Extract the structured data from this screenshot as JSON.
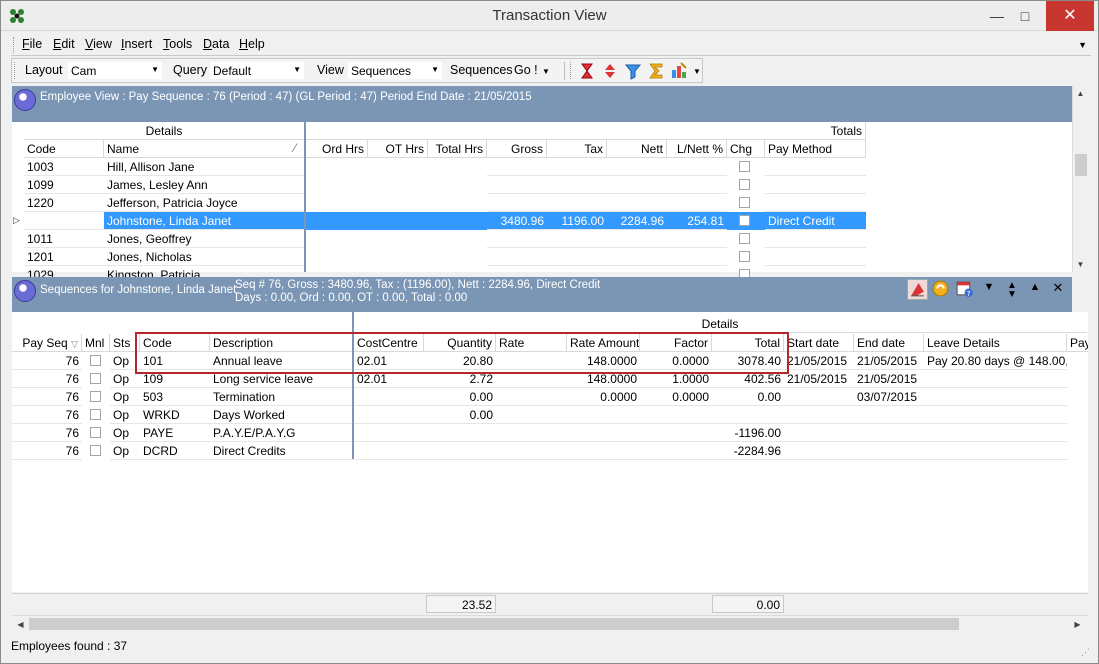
{
  "window": {
    "title": "Transaction View"
  },
  "menu": [
    {
      "label": "File",
      "u": "F",
      "rest": "ile"
    },
    {
      "label": "Edit",
      "u": "E",
      "rest": "dit"
    },
    {
      "label": "View",
      "u": "V",
      "rest": "iew"
    },
    {
      "label": "Insert",
      "u": "I",
      "rest": "nsert"
    },
    {
      "label": "Tools",
      "u": "T",
      "rest": "ools"
    },
    {
      "label": "Data",
      "u": "D",
      "rest": "ata"
    },
    {
      "label": "Help",
      "u": "H",
      "rest": "elp"
    }
  ],
  "toolbar": {
    "layout_label": "Layout",
    "layout_value": "Cam",
    "query_label": "Query",
    "query_value": "Default",
    "view_label": "View",
    "view_value": "Sequences",
    "sequences_label": "Sequences",
    "go_label": "Go !"
  },
  "employee_view": {
    "header": "Employee View : Pay Sequence : 76 (Period : 47) (GL Period : 47) Period End Date : 21/05/2015",
    "group_details": "Details",
    "group_totals": "Totals",
    "columns": [
      "Code",
      "Name",
      "Ord Hrs",
      "OT Hrs",
      "Total Hrs",
      "Gross",
      "Tax",
      "Nett",
      "L/Nett %",
      "Chg",
      "Pay Method"
    ],
    "rows": [
      {
        "code": "1003",
        "name": "Hill, Allison Jane",
        "gross": "",
        "tax": "",
        "nett": "",
        "lnett": "",
        "method": ""
      },
      {
        "code": "1099",
        "name": "James, Lesley Ann",
        "gross": "",
        "tax": "",
        "nett": "",
        "lnett": "",
        "method": ""
      },
      {
        "code": "1220",
        "name": "Jefferson, Patricia Joyce",
        "gross": "",
        "tax": "",
        "nett": "",
        "lnett": "",
        "method": ""
      },
      {
        "code": "1008",
        "name": "Johnstone, Linda Janet",
        "gross": "3480.96",
        "tax": "1196.00",
        "nett": "2284.96",
        "lnett": "254.81",
        "method": "Direct Credit"
      },
      {
        "code": "1011",
        "name": "Jones, Geoffrey",
        "gross": "",
        "tax": "",
        "nett": "",
        "lnett": "",
        "method": ""
      },
      {
        "code": "1201",
        "name": "Jones, Nicholas",
        "gross": "",
        "tax": "",
        "nett": "",
        "lnett": "",
        "method": ""
      },
      {
        "code": "1029",
        "name": "Kingston, Patricia",
        "gross": "",
        "tax": "",
        "nett": "",
        "lnett": "",
        "method": ""
      }
    ]
  },
  "sequences": {
    "header_title": "Sequences  for Johnstone, Linda Janet",
    "header_line1": "Seq # 76, Gross : 3480.96, Tax : (1196.00), Nett : 2284.96, Direct Credit",
    "header_line2": "Days : 0.00, Ord : 0.00, OT : 0.00, Total : 0.00",
    "group_details": "Details",
    "columns": [
      "Pay Seq",
      "Mnl",
      "Sts",
      "Code",
      "Description",
      "CostCentre",
      "Quantity",
      "Rate",
      "Rate Amount",
      "Factor",
      "Total",
      "Start date",
      "End date",
      "Leave Details",
      "Pay"
    ],
    "rows": [
      {
        "seq": "76",
        "sts": "Op",
        "code": "101",
        "desc": "Annual leave",
        "cc": "02.01",
        "qty": "20.80",
        "rate_amt": "148.0000",
        "factor": "0.0000",
        "total": "3078.40",
        "start": "21/05/2015",
        "end": "21/05/2015",
        "leave": "Pay 20.80 days @ 148.00, re"
      },
      {
        "seq": "76",
        "sts": "Op",
        "code": "109",
        "desc": "Long service leave",
        "cc": "02.01",
        "qty": "2.72",
        "rate_amt": "148.0000",
        "factor": "1.0000",
        "total": "402.56",
        "start": "21/05/2015",
        "end": "21/05/2015",
        "leave": ""
      },
      {
        "seq": "76",
        "sts": "Op",
        "code": "503",
        "desc": "Termination",
        "cc": "",
        "qty": "0.00",
        "rate_amt": "0.0000",
        "factor": "0.0000",
        "total": "0.00",
        "start": "",
        "end": "03/07/2015",
        "leave": ""
      },
      {
        "seq": "76",
        "sts": "Op",
        "code": "WRKD",
        "desc": "Days Worked",
        "cc": "",
        "qty": "0.00",
        "rate_amt": "",
        "factor": "",
        "total": "",
        "start": "",
        "end": "",
        "leave": ""
      },
      {
        "seq": "76",
        "sts": "Op",
        "code": "PAYE",
        "desc": "P.A.Y.E/P.A.Y.G",
        "cc": "",
        "qty": "",
        "rate_amt": "",
        "factor": "",
        "total": "-1196.00",
        "start": "",
        "end": "",
        "leave": ""
      },
      {
        "seq": "76",
        "sts": "Op",
        "code": "DCRD",
        "desc": "Direct Credits",
        "cc": "",
        "qty": "",
        "rate_amt": "",
        "factor": "",
        "total": "-2284.96",
        "start": "",
        "end": "",
        "leave": ""
      }
    ],
    "footer_quantity": "23.52",
    "footer_total": "0.00"
  },
  "status": {
    "text": "Employees found : 37"
  },
  "colors": {
    "header_blue": "#7b96b5",
    "selection": "#3399ff",
    "highlight_red": "#b6272b",
    "close_red": "#c7372f"
  }
}
